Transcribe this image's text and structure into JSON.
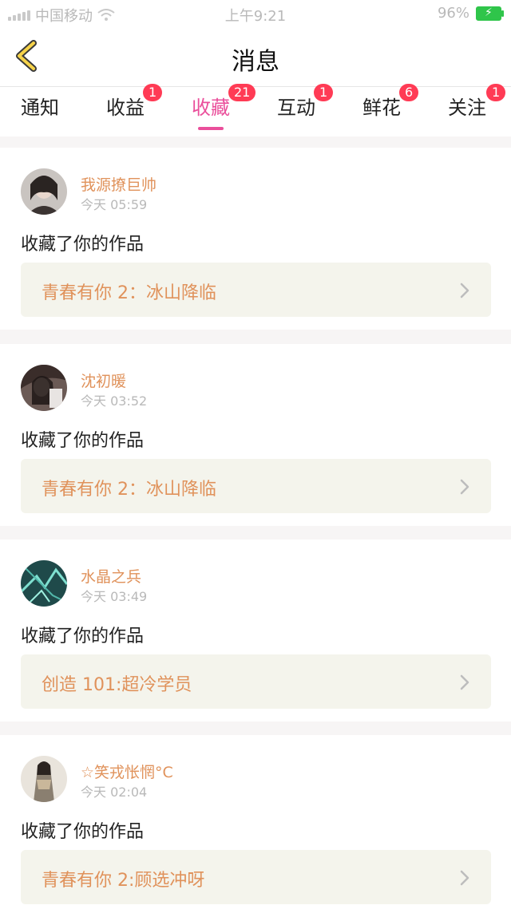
{
  "status_bar": {
    "carrier": "中国移动",
    "time": "上午9:21",
    "battery_percent": "96%",
    "icons": [
      "signal-icon",
      "wifi-icon",
      "battery-icon"
    ]
  },
  "header": {
    "title": "消息",
    "back_icon": "chevron-left-icon"
  },
  "tabs": [
    {
      "label": "通知",
      "badge": ""
    },
    {
      "label": "收益",
      "badge": "1"
    },
    {
      "label": "收藏",
      "badge": "21",
      "active": true
    },
    {
      "label": "互动",
      "badge": "1"
    },
    {
      "label": "鲜花",
      "badge": "6"
    },
    {
      "label": "关注",
      "badge": "1"
    }
  ],
  "feed": [
    {
      "user": "我源撩巨帅",
      "time": "今天 05:59",
      "action": "收藏了你的作品",
      "work": "青春有你 2：冰山降临"
    },
    {
      "user": "沈初暖",
      "time": "今天 03:52",
      "action": "收藏了你的作品",
      "work": "青春有你 2：冰山降临"
    },
    {
      "user": "水晶之兵",
      "time": "今天 03:49",
      "action": "收藏了你的作品",
      "work": "创造 101:超冷学员"
    },
    {
      "user": "☆笑戎怅惘°C",
      "time": "今天 02:04",
      "action": "收藏了你的作品",
      "work": "青春有你 2:顾选冲呀"
    }
  ],
  "colors": {
    "accent": "#ea4f9b",
    "badge": "#ff3b55",
    "username": "#e0925b",
    "work_bg": "#f4f4ec"
  }
}
